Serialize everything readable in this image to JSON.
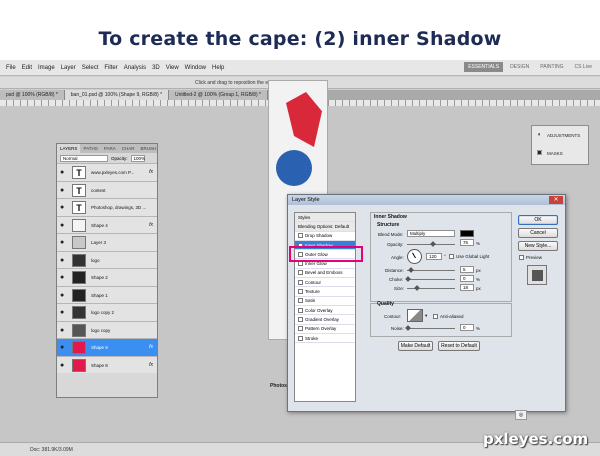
{
  "title": "To create the cape: (2) inner Shadow",
  "menubar": {
    "items": [
      "File",
      "Edit",
      "Image",
      "Layer",
      "Select",
      "Filter",
      "Analysis",
      "3D",
      "View",
      "Window",
      "Help"
    ],
    "workspaces": [
      "ESSENTIALS",
      "DESIGN",
      "PAINTING"
    ],
    "cslive": "CS Live"
  },
  "options_hint": "Click and drag to reposition the effect.",
  "tabs": [
    "psd @ 100% (RGB/8) *",
    "ban_01.psd @ 100% (Shape 9, RGB/8) *",
    "Untitled-2 @ 100% (Group 1, RGB/8) *"
  ],
  "status": "Doc: 381.9K/3.09M",
  "art_text": "Photosho",
  "adjustments": {
    "items": [
      "ADJUSTMENTS",
      "MASKS"
    ]
  },
  "layers_panel": {
    "tabs": [
      "LAYERS",
      "PATHS",
      "PARA",
      "CHAR",
      "BRUSH"
    ],
    "blend": "Normal",
    "opacity_label": "Opacity:",
    "opacity_value": "100%",
    "rows": [
      {
        "name": "www.pxleyes.com P...",
        "thumb": "T",
        "fx": "fx"
      },
      {
        "name": "contest",
        "thumb": "T",
        "fx": ""
      },
      {
        "name": "Photoshop, drawings, 3D ...",
        "thumb": "T",
        "fx": ""
      },
      {
        "name": "Shape 4",
        "thumb": "",
        "fx": "fx"
      },
      {
        "name": "Layer 3",
        "thumb": "",
        "fx": ""
      },
      {
        "name": "logo",
        "thumb": "",
        "fx": ""
      },
      {
        "name": "Shape 2",
        "thumb": "",
        "fx": ""
      },
      {
        "name": "Shape 1",
        "thumb": "",
        "fx": ""
      },
      {
        "name": "logo copy 2",
        "thumb": "",
        "fx": ""
      },
      {
        "name": "logo copy",
        "thumb": "",
        "fx": ""
      },
      {
        "name": "Shape 9",
        "thumb": "",
        "fx": "fx"
      },
      {
        "name": "Shape 8",
        "thumb": "",
        "fx": "fx"
      }
    ]
  },
  "dialog": {
    "title": "Layer Style",
    "styles": [
      {
        "label": "Styles",
        "checkbox": false
      },
      {
        "label": "Blending Options: Default",
        "checkbox": false
      },
      {
        "label": "Drop Shadow",
        "checkbox": true
      },
      {
        "label": "Inner Shadow",
        "checkbox": true
      },
      {
        "label": "Outer Glow",
        "checkbox": true
      },
      {
        "label": "Inner Glow",
        "checkbox": true
      },
      {
        "label": "Bevel and Emboss",
        "checkbox": true
      },
      {
        "label": "Contour",
        "checkbox": true
      },
      {
        "label": "Texture",
        "checkbox": true
      },
      {
        "label": "Satin",
        "checkbox": true
      },
      {
        "label": "Color Overlay",
        "checkbox": true
      },
      {
        "label": "Gradient Overlay",
        "checkbox": true
      },
      {
        "label": "Pattern Overlay",
        "checkbox": true
      },
      {
        "label": "Stroke",
        "checkbox": true
      }
    ],
    "section_title": "Inner Shadow",
    "structure": "Structure",
    "blend_mode_label": "Blend Mode:",
    "blend_mode_value": "Multiply",
    "opacity_label": "Opacity:",
    "opacity_value": "75",
    "percent": "%",
    "angle_label": "Angle:",
    "angle_value": "120",
    "angle_unit": "°",
    "global_light": "Use Global Light",
    "distance_label": "Distance:",
    "distance_value": "5",
    "choke_label": "Choke:",
    "choke_value": "0",
    "size_label": "Size:",
    "size_value": "18",
    "px": "px",
    "quality": "Quality",
    "contour_label": "Contour:",
    "antialiased": "Anti-aliased",
    "noise_label": "Noise:",
    "noise_value": "0",
    "make_default": "Make Default",
    "reset_default": "Reset to Default",
    "ok": "OK",
    "cancel": "Cancel",
    "new_style": "New Style...",
    "preview": "Preview"
  },
  "watermark": "pxleyes.com"
}
